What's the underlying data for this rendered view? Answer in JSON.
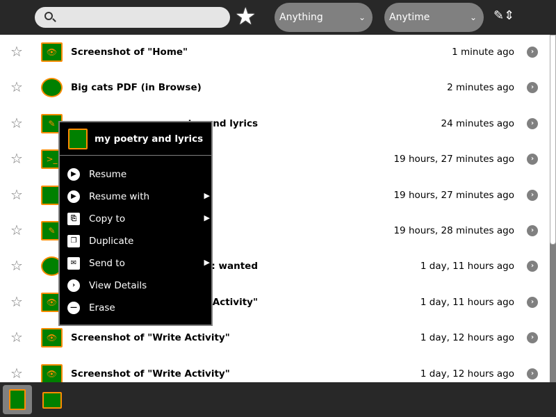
{
  "toolbar": {
    "search_placeholder": "",
    "search_value": "",
    "favorite_icon": "star-filled-icon",
    "what_filter": "Anything",
    "when_filter": "Anytime",
    "sort_icon": "view-sort-icon"
  },
  "entries": [
    {
      "title": "Screenshot of \"Home\"",
      "time": "1 minute ago",
      "icon": "image-viewer-icon"
    },
    {
      "title": "Big cats PDF (in Browse)",
      "time": "2 minutes ago",
      "icon": "browse-globe-icon"
    },
    {
      "title": "my poetry and lyrics",
      "time": "24 minutes ago",
      "icon": "write-document-icon"
    },
    {
      "title": "",
      "time": "19 hours, 27 minutes ago",
      "icon": "terminal-icon"
    },
    {
      "title": "",
      "time": "19 hours, 27 minutes ago",
      "icon": "drum-icon"
    },
    {
      "title": "",
      "time": "19 hours, 28 minutes ago",
      "icon": "write-document-icon"
    },
    {
      "title": ": wanted",
      "time": "1 day, 11 hours ago",
      "icon": "chat-globe-icon"
    },
    {
      "title": "Activity\"",
      "time": "1 day, 11 hours ago",
      "icon": "image-viewer-icon"
    },
    {
      "title": "Screenshot of \"Write Activity\"",
      "time": "1 day, 12 hours ago",
      "icon": "image-viewer-icon"
    },
    {
      "title": "Screenshot of \"Write Activity\"",
      "time": "1 day, 12 hours ago",
      "icon": "image-viewer-icon"
    }
  ],
  "context_menu": {
    "title": "my poetry and lyrics",
    "items": [
      {
        "label": "Resume",
        "icon": "play-icon",
        "submenu": false
      },
      {
        "label": "Resume with",
        "icon": "play-icon",
        "submenu": true
      },
      {
        "label": "Copy to",
        "icon": "copy-icon",
        "submenu": true
      },
      {
        "label": "Duplicate",
        "icon": "duplicate-icon",
        "submenu": false
      },
      {
        "label": "Send to",
        "icon": "mail-icon",
        "submenu": true
      },
      {
        "label": "View Details",
        "icon": "details-icon",
        "submenu": false
      },
      {
        "label": "Erase",
        "icon": "erase-icon",
        "submenu": false
      }
    ]
  },
  "scroll": {
    "position_fraction": 0.0,
    "visible_fraction": 0.6
  },
  "colors": {
    "accent_fill": "#008000",
    "accent_stroke": "#ff8c00"
  }
}
